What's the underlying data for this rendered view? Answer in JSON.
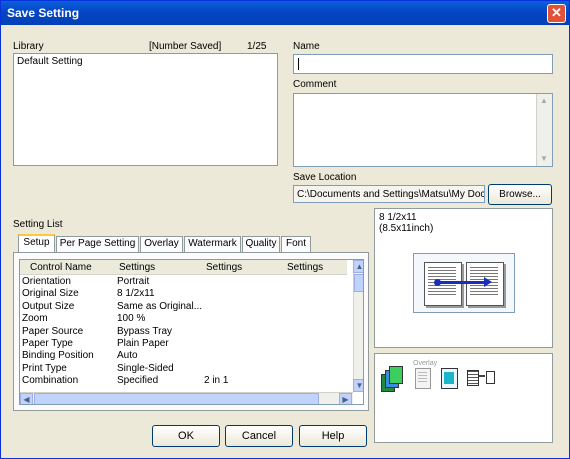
{
  "window": {
    "title": "Save Setting",
    "close": "✕"
  },
  "library": {
    "label": "Library",
    "number_saved_label": "[Number Saved]",
    "number_saved": "1/25",
    "items": [
      "Default Setting"
    ]
  },
  "name": {
    "label": "Name",
    "value": ""
  },
  "comment": {
    "label": "Comment",
    "value": ""
  },
  "save_location": {
    "label": "Save Location",
    "value": "C:\\Documents and Settings\\Matsu\\My Doc",
    "browse": "Browse..."
  },
  "setting_list": {
    "label": "Setting List",
    "tabs": [
      "Setup",
      "Per Page Setting",
      "Overlay",
      "Watermark",
      "Quality",
      "Font"
    ],
    "columns": [
      "Control Name",
      "Settings",
      "Settings",
      "Settings"
    ],
    "rows": [
      [
        "Orientation",
        "Portrait",
        ""
      ],
      [
        "Original Size",
        "8 1/2x11",
        ""
      ],
      [
        "Output Size",
        "Same as Original...",
        ""
      ],
      [
        "Zoom",
        "100 %",
        ""
      ],
      [
        "Paper Source",
        "Bypass Tray",
        ""
      ],
      [
        "Paper Type",
        "Plain Paper",
        ""
      ],
      [
        "Binding Position",
        "Auto",
        ""
      ],
      [
        "Print Type",
        "Single-Sided",
        ""
      ],
      [
        "Combination",
        "Specified",
        "2 in 1"
      ]
    ]
  },
  "preview": {
    "paper_size": "8 1/2x11",
    "paper_size_inch": "(8.5x11inch)",
    "overlay_label": "Overlay"
  },
  "buttons": {
    "ok": "OK",
    "cancel": "Cancel",
    "help": "Help"
  },
  "icons": {
    "close": "close-icon",
    "up": "scroll-up-arrow-icon",
    "down": "scroll-down-arrow-icon",
    "left": "scroll-left-arrow-icon",
    "right": "scroll-right-arrow-icon"
  },
  "colors": {
    "titlebar": "#0646c4",
    "close": "#e0533a",
    "tab_highlight": "#ffc83c",
    "face": "#ece9d8"
  }
}
